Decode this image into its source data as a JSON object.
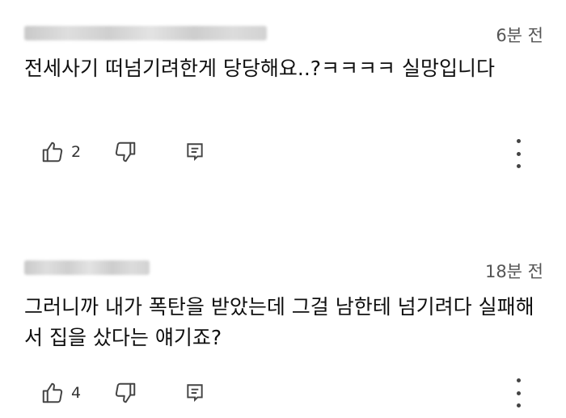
{
  "comments": [
    {
      "time": "6분 전",
      "text": "전세사기 떠넘기려한게 당당해요..?ㅋㅋㅋㅋ 실망입니다",
      "likes": "2"
    },
    {
      "time": "18분 전",
      "text": "그러니까 내가 폭탄을 받았는데 그걸 남한테 넘기려다 실패해서 집을 샀다는 얘기죠?",
      "likes": "4"
    }
  ],
  "icons": {
    "like": "thumbs-up-icon",
    "dislike": "thumbs-down-icon",
    "reply": "reply-icon",
    "menu": "more-vert-icon"
  },
  "colors": {
    "text": "#0f0f0f",
    "meta": "#555555",
    "icon": "#444444",
    "background": "#ffffff"
  }
}
